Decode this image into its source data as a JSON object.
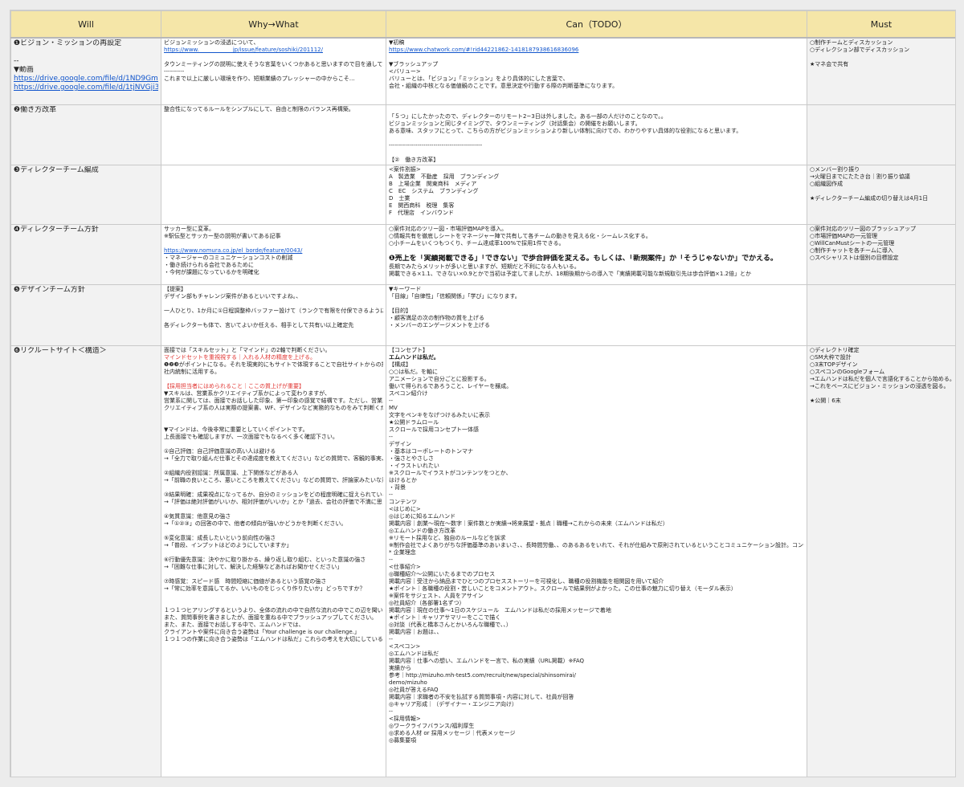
{
  "headers": [
    "Will",
    "Why→What",
    "Can（TODO）",
    "Must"
  ],
  "rows": [
    {
      "will": [
        "❶ビジョン・ミッションの再設定",
        "",
        "--",
        "▼動画",
        "https://drive.google.com/file/d/1ND9Gmkwia",
        "https://drive.google.com/file/d/1tjNVGji3NBC"
      ],
      "why": [
        "ビジョンミッションの浸透について、",
        "https://www.　　　　　　jp/issue/feature/soshiki/201112/",
        "",
        "タウンミーティングの説明に使えそうな言葉をいくつかあると思いますので目を通しておいてください。",
        "----------",
        "これまで以上に厳しい環境を作り、短期業績のプレッシャーの中からこそ…"
      ],
      "can": [
        "▼初稿",
        "https://www.chatwork.com/#!rid44221862-1418187938616836096",
        "",
        "▼ブラッシュアップ",
        "<バリュー>",
        "バリューとは、「ビジョン」「ミッション」をより具体的にした言葉で、",
        "会社・組織の中核となる価値観のことです。意思決定や行動する際の判断基準になります。"
      ],
      "must": [
        "○制作チームとディスカッション",
        "○ディレクション部でディスカッション",
        "",
        "★マネ会で共有"
      ]
    },
    {
      "will": [
        "❷働き方改革"
      ],
      "why": [
        "整合性になってるルールをシンプルにして、自由と制限のバランス再構築。"
      ],
      "can": [
        "",
        "「５つ」にしたかったので、ディレクターのリモート2~3日は外しました。ある一部の人だけのことなので。。",
        "ビジョンミッションと同じタイミングで、タウンミーティング（対話集会）の開催をお願いします。",
        "ある意味、スタッフにとって、こちらの方がビジョンミッションより新しい体制に向けての、わかりやすい具体的な役割になると思います。",
        "",
        "----------------------------------------------",
        "",
        "【②　働き方改革】"
      ],
      "must": []
    },
    {
      "will": [
        "❸ディレクターチーム編成"
      ],
      "why": [],
      "can": [
        "<案件割振>",
        "A　製造業　不動産　採用　ブランディング",
        "B　上場企業　関東商科　メディア",
        "C　EC　システム　ブランディング",
        "D　士業",
        "E　関西商科　税理　集客",
        "F　代理店　インバウンド"
      ],
      "must": [
        "○メンバー割り振り",
        "→火曜日までにたたき台｜割り振り協議",
        "○組織図作成",
        "",
        "★ディレクターチーム編成の切り替えは4月1日"
      ]
    },
    {
      "will": [
        "❹ディレクターチーム方針"
      ],
      "why": [
        "サッカー型に変革。",
        "※駅伝型とサッカー型の説明が書いてある記事",
        "",
        "https://www.nomura.co.jp/el_borde/feature/0043/",
        "・マネージャーのコミュニケーションコストの削減",
        "・働き続けられる会社であるために",
        "・今何が課題になっているかを明確化"
      ],
      "can": [
        "○案件対応のツリー図・市場評価MAPを導入。",
        "○情報共有を徹底しシートをマネージャー陣で共有して各チームの動きを見える化・シームレス化する。",
        "○小チームをいくつもつくり、チーム達成率100%で採用1件できる。",
        "",
        "❶売上を「実績掲載できる」「できない」で歩合評価を変える。もしくは、「新規案件」か「そうじゃないか」でかえる。",
        "長期でみたらメリットが多いと思いますが、短期だと不利になる人もいる。",
        "掲載できる×1.1、できない×0.9とかで当初は予定してましたが、18期後期からの導入で「実績掲載可能な新規取引先は歩合評価×1.2倍」とか"
      ],
      "must": [
        "○案件対応のツリー図のブラッシュアップ",
        "○市場評価MAPの一元管理",
        "○WillCanMustシートの一元管理",
        "○制作チャットを各チームに導入",
        "○スペシャリストは個別の目標設定"
      ]
    },
    {
      "will": [
        "❺デザインチーム方針"
      ],
      "why": [
        "【提案】",
        "デザイン部もチャレンジ案件があるといいですよね。、",
        "",
        "一人ひとり、1か月に①日程調整枠バッファー設けて（ランクで有限を付保できるようにする）。。自由度があるというか、、チーム横断して案件にとりくむとか、、（TOPデザイナーの縛りを抜けて、、）",
        "",
        "各ディレクターも体で、言いてよいか任える、相手として共有い以上確定先"
      ],
      "can": [
        "▼キーワード",
        "「目線」「自律性」「信頼関係」「学び」になります。",
        "",
        "【目的】",
        "・顧客満足の次の制作物の質を上げる",
        "・メンバーのエンゲージメントを上げる"
      ],
      "must": []
    },
    {
      "will": [
        "❻リクルートサイト＜構造＞"
      ],
      "why": [
        "面接では「スキルセット」と「マインド」の2軸で判断ください。",
        "[[red]]マインドセットを重視視する｜入れる人材の精度を上げる。",
        "❶❷❸がポイントになる。それを現実的にもサイトで体現することで自社サイトからの採用になる。（コスト削減）",
        "社内統制に活用する。",
        "",
        "[[red]]【採用担当者にはめられること｜ここの質上げが重要】",
        "▼スキルは、営業系かクリエイティブ系かによって変わりますが、",
        "営業系に関しては、面接でお話しした印象、第一印象の感覚で結構です。ただし、営業系であっても、WFの作成経験がゼロの場合は、採用は厳しいです。",
        "クリエイティブ系の人は実際の提案書、WF、デザインなど実務的なものをみて判断ください。",
        "",
        "",
        "▼マインドは、今後非常に重要としていくポイントです。",
        "上長面接でも確認しますが、一次面接でもなるべく多く確認下さい。",
        "",
        "①自己評価：自己評価意識の高い人は避ける",
        "→「全力で取り組んだ仕事とその達成度を教えてください」などの質問で、客観的事実、達成率などの定量的実績を述べてくる候補者はgood。",
        "",
        "②組織内役割認識：所属意識、上下関係などがある人",
        "→「前職の良いところ、悪いところを教えてください」などの質問で、評論家みたいな意見や上司のお話しになれば採れるかも。",
        "",
        "③結果明確：成果視点になってるか、自分のミッションをどの程度明確に捉えられているかの度合い",
        "→「評価は絶対評価がいいか、相対評価がいいか」とか「過去、会社の評価で不満に思ったことありますか」とか聞いてみてください。",
        "",
        "④気質意識：他意見の強さ",
        "→「①②③」の回答の中で、他者の傾向が強いかどうかを判断ください。",
        "",
        "⑤変化意識：成長したいという前向性の強さ",
        "→「普段、インプットはどのようにしていますか」",
        "",
        "⑥行動優先意識：決やかに取り掛かる、繰り返し取り組む、といった意識の強さ",
        "→「困難な仕事に対して、解決した経験などあればお聞かせください」",
        "",
        "⑦時感覚：スピード感　時間短縮に価値があるという感覚の強さ",
        "→「常に効率を意識してるか、いいものをじっくり作りたいか」どっちですか？",
        "",
        "",
        "１つ１つヒアリングするというより、全体の流れの中で自然な流れの中でこの辺を聞いてみてください。",
        "また、質問事例を書きましたが、面接を重ねる中でブラッシュアップしてください。",
        "また、また、面接でお話しする中で、エムハンドでは、",
        "クライアントや案件に向き合う姿勢は「Your challenge is our challenge.」",
        "１つ１つの作業に向き合う姿勢は「エムハンドは私だ」これらの考えを大切にしていることもお伝えください。"
      ],
      "can": [
        "【コンセプト】",
        "[[bold]]エムハンドは私だ。",
        "【構成】",
        "○○は私だ。を軸に",
        "アニメーションで自分ごとに投影する。",
        "働いて得られるであろうこと、レイヤーを醸成。",
        "スペコン紹介け",
        "--",
        "MV",
        "文字をペンキをなげつけるみたいに表示",
        "★公開ドラムロール",
        "スクロールで採用コンセプト一体感",
        "--",
        "デザイン",
        "・基本はコーポレートのトンマナ",
        "・強さとやさしさ",
        "・イラストいれたい",
        "※スクロールでイラストがコンテンツをつとか、",
        "はけるとか",
        "・背景",
        "--",
        "コンテンツ",
        "<はじめに>",
        "◎はじめに知るエムハンド",
        "掲載内容｜創業〜現在〜数字｜案件数とか実績→将来展望・拠点｜職種→これからの未来（エムハンドは私だ）",
        "◎エムハンドの働き方改革",
        "※リモート採用など、独自のルールなどを訴求",
        "※制作会社でよくありがちな評価基準のあいまいさ、、長時間労働、、のあるあるをいれて、それが仕組みで原則されているということコミュニケーション設計。コンテンツ上位の位置付け。",
        "* 企業理念",
        "--",
        "<仕事紹介>",
        "◎職種紹介〜公開にいたるまでのプロセス",
        "掲載内容｜受注から納品までひとつのプロセスストーリーを可視化し、職種の役割機能を相関図を用いて紹介",
        "★ポイント｜各職種の役割・苦しいことをコメントアウト。スクロールで結果例がよかった。この仕事の魅力に切り替え（モーダル表示）",
        "※案件をサジェスト、人員をアサイン",
        "◎社員紹介（各部署1名ずつ）",
        "掲載内容｜現在の仕事〜1日のスケジュール　エムハンドは私だの採用メッセージで着地",
        "★ポイント｜キャリアサマリーをここで描く",
        "◎対談（代表と橋本さんとかいろんな職種で、、）",
        "掲載内容｜お題は、、",
        "--",
        "<スペコン>",
        "◎エムハンドは私だ",
        "掲載内容｜仕事への想い、エムハンドを一言で、私の実績（URL掲載）※FAQ",
        "実績から",
        "参考｜http://mizuho.mh-test5.com/recruit/new/special/shinsomirai/",
        "demo/mizuho",
        "◎社員が答えるFAQ",
        "掲載内容｜求職者の不安を払拭する質問事項・内容に対して、社員が回答",
        "◎キャリア形成｜（デザイナー・エンジニア向け）",
        "--",
        "<採用情報>",
        "◎ワークライフバランス/福利厚生",
        "◎求める人材 or 採用メッセージ｜代表メッセージ",
        "◎募集要項"
      ],
      "must": [
        "○ディレクトリ確定",
        "○SM大枠で設計",
        "○3末TOPデザイン",
        "○スペコンのGoogleフォーム",
        "→エムハンドは私だを個人で言語化することから始める。",
        "→これをベースにビジョン・ミッションの浸透を図る。",
        "",
        "★公開｜6末"
      ]
    }
  ],
  "colors": {
    "header_bg": "#f5e6a8",
    "grid": "#c9c9c9",
    "link": "#1155cc",
    "accent_red": "#e0322f"
  }
}
